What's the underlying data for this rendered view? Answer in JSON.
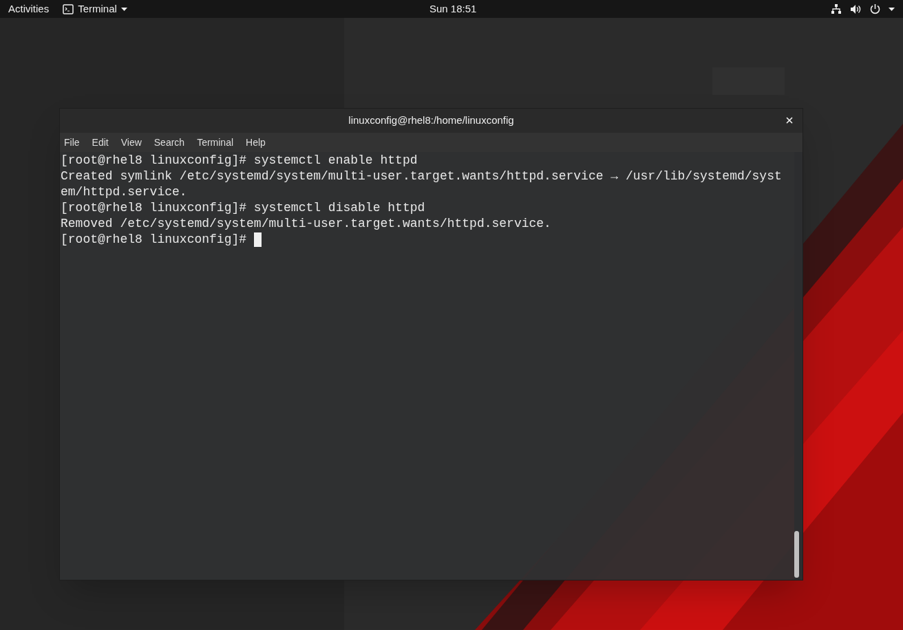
{
  "top_bar": {
    "activities": "Activities",
    "app_menu": "Terminal",
    "clock": "Sun 18:51"
  },
  "terminal_window": {
    "title": "linuxconfig@rhel8:/home/linuxconfig",
    "menu": [
      "File",
      "Edit",
      "View",
      "Search",
      "Terminal",
      "Help"
    ],
    "lines": [
      "[root@rhel8 linuxconfig]# systemctl enable httpd",
      "Created symlink /etc/systemd/system/multi-user.target.wants/httpd.service → /usr/lib/systemd/syst",
      "em/httpd.service.",
      "[root@rhel8 linuxconfig]# systemctl disable httpd",
      "Removed /etc/systemd/system/multi-user.target.wants/httpd.service.",
      "[root@rhel8 linuxconfig]# "
    ],
    "cursor": true
  }
}
